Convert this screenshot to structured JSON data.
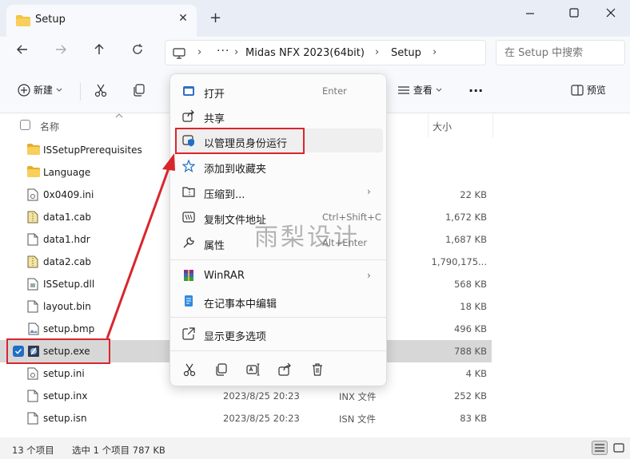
{
  "window": {
    "tab_title": "Setup",
    "tab_close": "✕",
    "new_tab": "+"
  },
  "address": {
    "ellipsis": "···",
    "crumbs": [
      "Midas NFX 2023(64bit)",
      "Setup"
    ],
    "separator": "›"
  },
  "search": {
    "placeholder": "在 Setup 中搜索"
  },
  "toolbar": {
    "new_label": "新建",
    "view_label": "查看",
    "more_label": "···",
    "preview_label": "预览"
  },
  "columns": {
    "name": "名称",
    "size": "大小"
  },
  "files": [
    {
      "name": "ISSetupPrerequisites",
      "date": "",
      "type": "",
      "size": "",
      "icon": "folder-icon"
    },
    {
      "name": "Language",
      "date": "",
      "type": "",
      "size": "",
      "icon": "folder-icon"
    },
    {
      "name": "0x0409.ini",
      "date": "",
      "type": "",
      "size": "22 KB",
      "icon": "ini-file-icon"
    },
    {
      "name": "data1.cab",
      "date": "",
      "type": "",
      "size": "1,672 KB",
      "icon": "cab-file-icon"
    },
    {
      "name": "data1.hdr",
      "date": "",
      "type": "",
      "size": "1,687 KB",
      "icon": "file-icon"
    },
    {
      "name": "data2.cab",
      "date": "",
      "type": "",
      "size": "1,790,175...",
      "icon": "cab-file-icon"
    },
    {
      "name": "ISSetup.dll",
      "date": "",
      "type": "展",
      "size": "568 KB",
      "icon": "dll-file-icon"
    },
    {
      "name": "layout.bin",
      "date": "",
      "type": "",
      "size": "18 KB",
      "icon": "file-icon"
    },
    {
      "name": "setup.bmp",
      "date": "",
      "type": "文件",
      "size": "496 KB",
      "icon": "bmp-file-icon"
    },
    {
      "name": "setup.exe",
      "date": "",
      "type": "",
      "size": "788 KB",
      "icon": "exe-file-icon"
    },
    {
      "name": "setup.ini",
      "date": "",
      "type": "",
      "size": "4 KB",
      "icon": "ini-file-icon"
    },
    {
      "name": "setup.inx",
      "date": "2023/8/25 20:23",
      "type": "INX 文件",
      "size": "252 KB",
      "icon": "file-icon"
    },
    {
      "name": "setup.isn",
      "date": "2023/8/25 20:23",
      "type": "ISN 文件",
      "size": "83 KB",
      "icon": "file-icon"
    }
  ],
  "status": {
    "count": "13 个项目",
    "selected": "选中 1 个项目  787 KB"
  },
  "menu": {
    "open": {
      "label": "打开",
      "shortcut": "Enter"
    },
    "share": {
      "label": "共享"
    },
    "run_as_admin": {
      "label": "以管理员身份运行"
    },
    "add_favorites": {
      "label": "添加到收藏夹"
    },
    "compress": {
      "label": "压缩到...",
      "arrow": "›"
    },
    "copy_path": {
      "label": "复制文件地址",
      "shortcut": "Ctrl+Shift+C"
    },
    "properties": {
      "label": "属性",
      "shortcut": "Alt+Enter"
    },
    "winrar": {
      "label": "WinRAR",
      "arrow": "›"
    },
    "notepad": {
      "label": "在记事本中编辑"
    },
    "more_options": {
      "label": "显示更多选项"
    }
  },
  "watermark": "雨梨设计",
  "colors": {
    "highlight_red": "#d9262d",
    "selection_blue": "#1f6fc5",
    "folder_yellow": "#f4c242"
  }
}
